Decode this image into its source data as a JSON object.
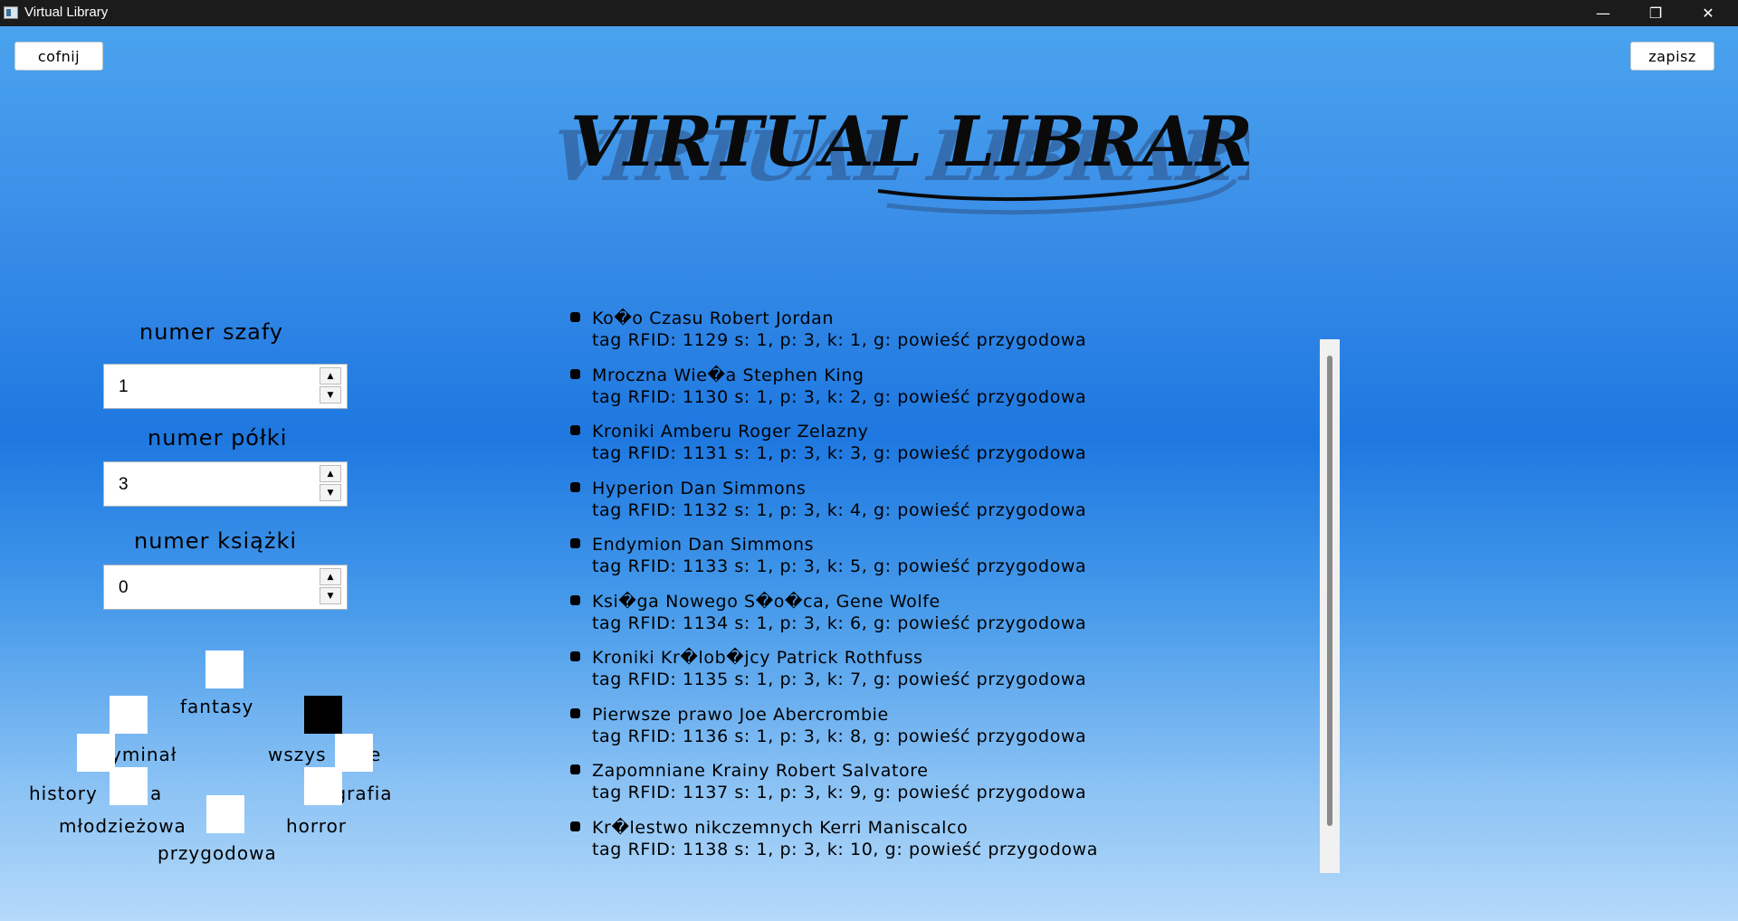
{
  "window": {
    "title": "Virtual Library",
    "controls": {
      "minimize": "—",
      "maximize": "❐",
      "close": "✕"
    }
  },
  "toolbar": {
    "back_label": "cofnij",
    "save_label": "zapisz"
  },
  "logo": {
    "text": "Virtual Library"
  },
  "fields": {
    "shelf_unit": {
      "label": "numer szafy",
      "value": "1"
    },
    "shelf": {
      "label": "numer półki",
      "value": "3"
    },
    "book": {
      "label": "numer książki",
      "value": "0"
    }
  },
  "genres": {
    "fantasy": "fantasy",
    "kryminal": "yminał",
    "wszystkie": "wszys",
    "wszystkie_tail": "e",
    "historyczna": "history",
    "historyczna_tail": "a",
    "biografia": "biografia",
    "mlodziezowa": "młodzieżowa",
    "horror": "horror",
    "przygodowa": "przygodowa",
    "selected": "wszystkie"
  },
  "books": [
    {
      "title": "Ko�o Czasu Robert Jordan",
      "details": "tag RFID: 1129 s: 1, p: 3, k: 1, g: powieść przygodowa"
    },
    {
      "title": "Mroczna Wie�a Stephen King",
      "details": "tag RFID: 1130 s: 1, p: 3, k: 2, g: powieść przygodowa"
    },
    {
      "title": "Kroniki Amberu Roger Zelazny",
      "details": "tag RFID: 1131 s: 1, p: 3, k: 3, g: powieść przygodowa"
    },
    {
      "title": "Hyperion Dan Simmons",
      "details": "tag RFID: 1132 s: 1, p: 3, k: 4, g: powieść przygodowa"
    },
    {
      "title": "Endymion Dan Simmons",
      "details": "tag RFID: 1133 s: 1, p: 3, k: 5, g: powieść przygodowa"
    },
    {
      "title": "Ksi�ga Nowego S�o�ca, Gene Wolfe",
      "details": "tag RFID: 1134 s: 1, p: 3, k: 6, g: powieść przygodowa"
    },
    {
      "title": "Kroniki Kr�lob�jcy Patrick Rothfuss",
      "details": "tag RFID: 1135 s: 1, p: 3, k: 7, g: powieść przygodowa"
    },
    {
      "title": "Pierwsze prawo Joe Abercrombie",
      "details": "tag RFID: 1136 s: 1, p: 3, k: 8, g: powieść przygodowa"
    },
    {
      "title": "Zapomniane Krainy Robert Salvatore",
      "details": "tag RFID: 1137 s: 1, p: 3, k: 9, g: powieść przygodowa"
    },
    {
      "title": "Kr�lestwo nikczemnych Kerri Maniscalco",
      "details": "tag RFID: 1138 s: 1, p: 3, k: 10, g: powieść przygodowa"
    }
  ],
  "colors": {
    "background_top": "#4aa3ee",
    "background_mid": "#1e78e0",
    "background_bottom": "#b4d9f9",
    "titlebar": "#1b1b1b"
  }
}
